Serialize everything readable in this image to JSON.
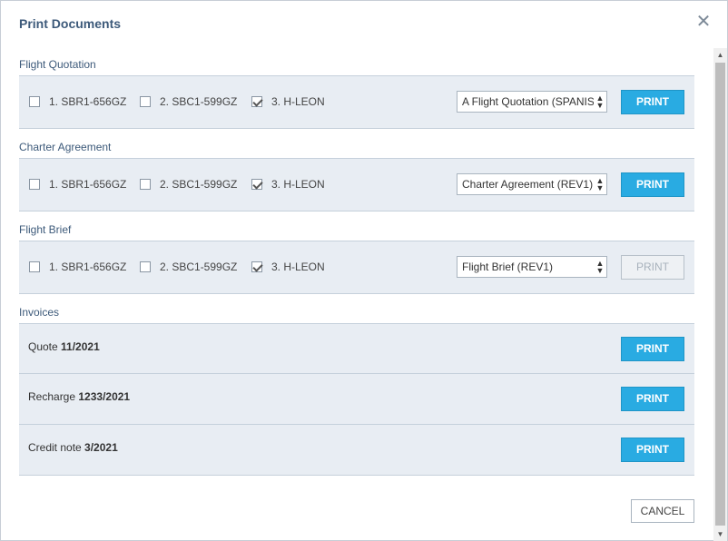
{
  "dialog": {
    "title": "Print Documents",
    "close_icon": "close-icon",
    "cancel_label": "CANCEL"
  },
  "sections": [
    {
      "title": "Flight Quotation",
      "options": [
        {
          "label": "1. SBR1-656GZ",
          "checked": false
        },
        {
          "label": "2. SBC1-599GZ",
          "checked": false
        },
        {
          "label": "3. H-LEON",
          "checked": true
        }
      ],
      "select_value": "A Flight Quotation (SPANISH)",
      "print_label": "PRINT",
      "print_enabled": true
    },
    {
      "title": "Charter Agreement",
      "options": [
        {
          "label": "1. SBR1-656GZ",
          "checked": false
        },
        {
          "label": "2. SBC1-599GZ",
          "checked": false
        },
        {
          "label": "3. H-LEON",
          "checked": true
        }
      ],
      "select_value": "Charter Agreement (REV1)",
      "print_label": "PRINT",
      "print_enabled": true
    },
    {
      "title": "Flight Brief",
      "options": [
        {
          "label": "1. SBR1-656GZ",
          "checked": false
        },
        {
          "label": "2. SBC1-599GZ",
          "checked": false
        },
        {
          "label": "3. H-LEON",
          "checked": true
        }
      ],
      "select_value": "Flight Brief (REV1)",
      "print_label": "PRINT",
      "print_enabled": false
    }
  ],
  "invoices": {
    "title": "Invoices",
    "items": [
      {
        "type": "Quote",
        "number": "11/2021",
        "print_label": "PRINT"
      },
      {
        "type": "Recharge",
        "number": "1233/2021",
        "print_label": "PRINT"
      },
      {
        "type": "Credit note",
        "number": "3/2021",
        "print_label": "PRINT"
      }
    ]
  },
  "scrollbar": {
    "up_icon": "scroll-up-arrow-icon",
    "down_icon": "scroll-down-arrow-icon"
  },
  "colors": {
    "accent": "#29abe2",
    "title": "#3d5a7a",
    "row_bg": "#e8edf3"
  }
}
